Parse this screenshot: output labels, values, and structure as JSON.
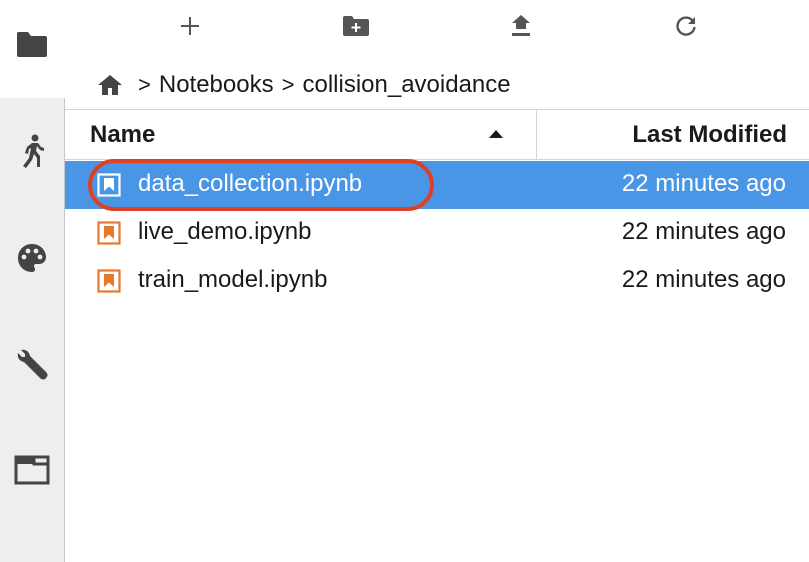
{
  "toolbar": {
    "new_launcher_icon": "plus-icon",
    "new_folder_icon": "new-folder-icon",
    "upload_icon": "upload-icon",
    "refresh_icon": "refresh-icon"
  },
  "sidebar": {
    "items": [
      {
        "icon": "folder-icon"
      },
      {
        "icon": "running-icon"
      },
      {
        "icon": "palette-icon"
      },
      {
        "icon": "wrench-icon"
      },
      {
        "icon": "tabs-icon"
      }
    ]
  },
  "breadcrumb": {
    "home_icon": "home-icon",
    "separator": ">",
    "items": [
      "Notebooks",
      "collision_avoidance"
    ]
  },
  "file_list": {
    "header": {
      "name": "Name",
      "last_modified": "Last Modified",
      "sort": "ascending"
    },
    "files": [
      {
        "name": "data_collection.ipynb",
        "modified": "22 minutes ago",
        "selected": true
      },
      {
        "name": "live_demo.ipynb",
        "modified": "22 minutes ago",
        "selected": false
      },
      {
        "name": "train_model.ipynb",
        "modified": "22 minutes ago",
        "selected": false
      }
    ]
  },
  "colors": {
    "selection": "#4a96e6",
    "notebook_icon": "#e6772e",
    "highlight_ring": "#dd4125"
  }
}
